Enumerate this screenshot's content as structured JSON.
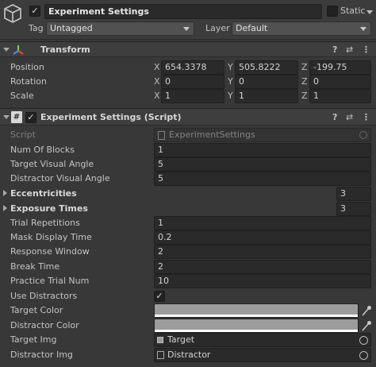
{
  "gameobject": {
    "name": "Experiment Settings",
    "active_checked": true,
    "static_label": "Static",
    "tag_label": "Tag",
    "tag_value": "Untagged",
    "layer_label": "Layer",
    "layer_value": "Default",
    "cube_icon": "cube-icon"
  },
  "transform": {
    "title": "Transform",
    "position": {
      "label": "Position",
      "x": "654.3378",
      "y": "505.8222",
      "z": "-199.75"
    },
    "rotation": {
      "label": "Rotation",
      "x": "0",
      "y": "0",
      "z": "0"
    },
    "scale": {
      "label": "Scale",
      "x": "1",
      "y": "1",
      "z": "1"
    },
    "axis_x": "X",
    "axis_y": "Y",
    "axis_z": "Z"
  },
  "script_component": {
    "title": "Experiment Settings (Script)",
    "enabled_checked": true,
    "script_label": "Script",
    "script_value": "ExperimentSettings",
    "fields": {
      "num_of_blocks": {
        "label": "Num Of Blocks",
        "value": "1"
      },
      "target_visual_angle": {
        "label": "Target Visual Angle",
        "value": "5"
      },
      "distractor_visual_angle": {
        "label": "Distractor Visual Angle",
        "value": "5"
      },
      "eccentricities": {
        "label": "Eccentricities",
        "value": "3"
      },
      "exposure_times": {
        "label": "Exposure Times",
        "value": "3"
      },
      "trial_repetitions": {
        "label": "Trial Repetitions",
        "value": "1"
      },
      "mask_display_time": {
        "label": "Mask Display Time",
        "value": "0.2"
      },
      "response_window": {
        "label": "Response Window",
        "value": "2"
      },
      "break_time": {
        "label": "Break Time",
        "value": "2"
      },
      "practice_trial_num": {
        "label": "Practice Trial Num",
        "value": "10"
      },
      "use_distractors": {
        "label": "Use Distractors",
        "checked": true
      },
      "target_color": {
        "label": "Target Color",
        "color": "#9c9c9c"
      },
      "distractor_color": {
        "label": "Distractor Color",
        "color": "#9c9c9c"
      },
      "target_img": {
        "label": "Target Img",
        "value": "Target"
      },
      "distractor_img": {
        "label": "Distractor Img",
        "value": "Distractor"
      }
    }
  },
  "colors": {
    "background": "#383838",
    "header": "#3e3e3e",
    "field": "#2a2a2a",
    "text": "#c4c4c4"
  }
}
